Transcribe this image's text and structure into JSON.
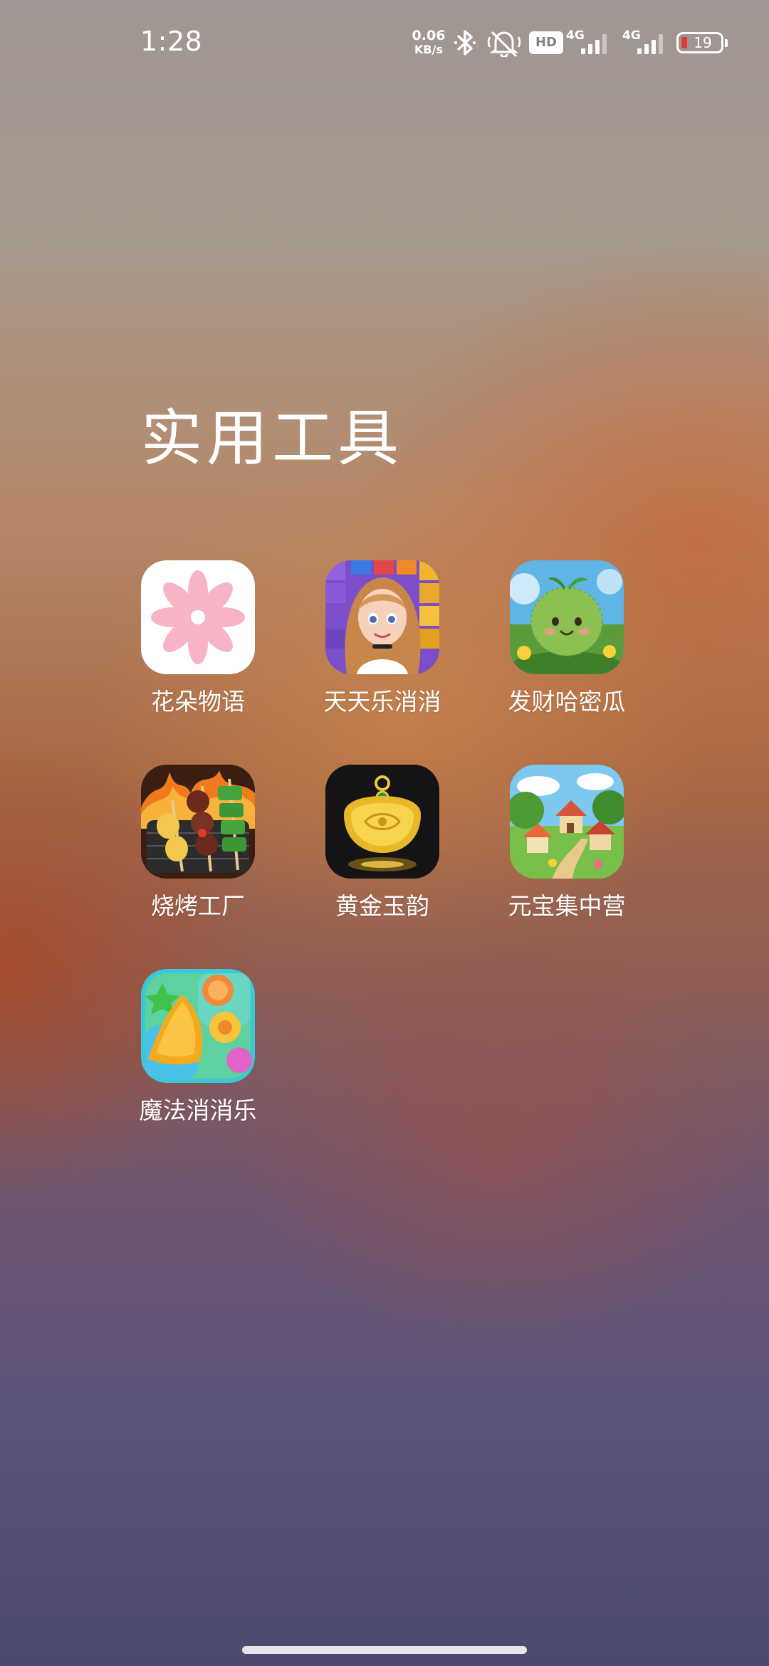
{
  "status_bar": {
    "time": "1:28",
    "net_speed_value": "0.06",
    "net_speed_unit": "KB/s",
    "hd_badge": "HD",
    "signal1_label": "4G",
    "signal2_label": "4G",
    "battery_level": "19",
    "icons": [
      "bluetooth-icon",
      "mute-icon",
      "hd-voice-icon",
      "signal-icon",
      "signal-icon",
      "battery-icon"
    ]
  },
  "folder": {
    "title": "实用工具",
    "apps": [
      {
        "label": "花朵物语",
        "icon": "flower-app-icon"
      },
      {
        "label": "天天乐消消",
        "icon": "girl-puzzle-app-icon"
      },
      {
        "label": "发财哈密瓜",
        "icon": "melon-app-icon"
      },
      {
        "label": "烧烤工厂",
        "icon": "bbq-app-icon"
      },
      {
        "label": "黄金玉韵",
        "icon": "gold-lock-app-icon"
      },
      {
        "label": "元宝集中营",
        "icon": "village-app-icon"
      },
      {
        "label": "魔法消消乐",
        "icon": "candy-app-icon"
      }
    ]
  },
  "colors": {
    "battery_low": "#e33b33",
    "text": "#ffffff"
  }
}
